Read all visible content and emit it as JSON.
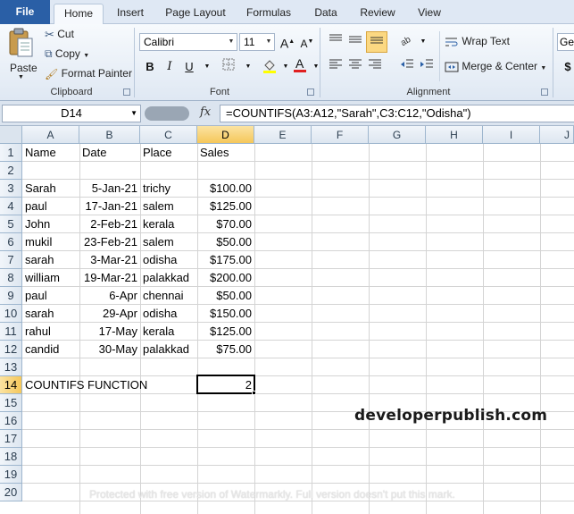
{
  "ribbon_tabs": [
    "File",
    "Home",
    "Insert",
    "Page Layout",
    "Formulas",
    "Data",
    "Review",
    "View"
  ],
  "clipboard": {
    "paste": "Paste",
    "cut": "Cut",
    "copy": "Copy",
    "format_painter": "Format Painter",
    "label": "Clipboard"
  },
  "font": {
    "name": "Calibri",
    "size": "11",
    "label": "Font"
  },
  "alignment": {
    "wrap_text": "Wrap Text",
    "merge_center": "Merge & Center",
    "label": "Alignment"
  },
  "number": {
    "format_partial": "Ge",
    "currency_symbol": "$"
  },
  "formula_bar": {
    "name_box": "D14",
    "fx": "fx",
    "formula": "=COUNTIFS(A3:A12,\"Sarah\",C3:C12,\"Odisha\")"
  },
  "columns": [
    "A",
    "B",
    "C",
    "D",
    "E",
    "F",
    "G",
    "H",
    "I",
    "J"
  ],
  "rows": [
    "1",
    "2",
    "3",
    "4",
    "5",
    "6",
    "7",
    "8",
    "9",
    "10",
    "11",
    "12",
    "13",
    "14",
    "15",
    "16",
    "17",
    "18",
    "19",
    "20"
  ],
  "headers": {
    "name": "Name",
    "date": "Date",
    "place": "Place",
    "sales": "Sales"
  },
  "data_rows": [
    {
      "name": "Sarah",
      "date": "5-Jan-21",
      "place": "trichy",
      "sales": "$100.00"
    },
    {
      "name": "paul",
      "date": "17-Jan-21",
      "place": "salem",
      "sales": "$125.00"
    },
    {
      "name": "John",
      "date": "2-Feb-21",
      "place": "kerala",
      "sales": "$70.00"
    },
    {
      "name": "mukil",
      "date": "23-Feb-21",
      "place": "salem",
      "sales": "$50.00"
    },
    {
      "name": "sarah",
      "date": "3-Mar-21",
      "place": "odisha",
      "sales": "$175.00"
    },
    {
      "name": "william",
      "date": "19-Mar-21",
      "place": "palakkad",
      "sales": "$200.00"
    },
    {
      "name": "paul",
      "date": "6-Apr",
      "place": "chennai",
      "sales": "$50.00"
    },
    {
      "name": "sarah",
      "date": "29-Apr",
      "place": "odisha",
      "sales": "$150.00"
    },
    {
      "name": "rahul",
      "date": "17-May",
      "place": "kerala",
      "sales": "$125.00"
    },
    {
      "name": "candid",
      "date": "30-May",
      "place": "palakkad",
      "sales": "$75.00"
    }
  ],
  "summary": {
    "label": "COUNTIFS FUNCTION",
    "result": "2"
  },
  "brand": "developerpublish.com",
  "watermark": "Protected with free version of Watermarkly. Full version doesn't put this mark."
}
